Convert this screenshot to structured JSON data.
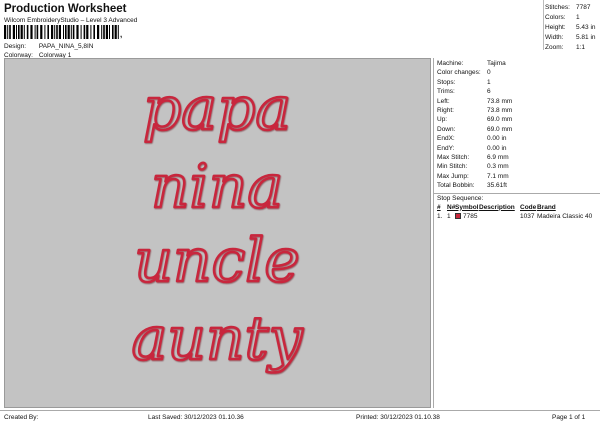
{
  "header": {
    "title": "Production Worksheet",
    "subtitle": "Wilcom EmbroideryStudio – Level 3 Advanced",
    "design_label": "Design:",
    "design_value": "PAPA_NINA_5,8IN",
    "colorway_label": "Colorway:",
    "colorway_value": "Colorway 1",
    "barcode_suffix": ","
  },
  "summary": [
    {
      "k": "Stitches:",
      "v": "7787"
    },
    {
      "k": "Colors:",
      "v": "1"
    },
    {
      "k": "Height:",
      "v": "5.43 in"
    },
    {
      "k": "Width:",
      "v": "5.81 in"
    },
    {
      "k": "Zoom:",
      "v": "1:1"
    }
  ],
  "params": [
    {
      "k": "Machine:",
      "v": "Tajima"
    },
    {
      "k": "Color changes:",
      "v": "0"
    },
    {
      "k": "Stops:",
      "v": "1"
    },
    {
      "k": "Trims:",
      "v": "6"
    },
    {
      "k": "Left:",
      "v": "73.8 mm"
    },
    {
      "k": "Right:",
      "v": "73.8 mm"
    },
    {
      "k": "Up:",
      "v": "69.0 mm"
    },
    {
      "k": "Down:",
      "v": "69.0 mm"
    },
    {
      "k": "EndX:",
      "v": "0.00 in"
    },
    {
      "k": "EndY:",
      "v": "0.00 in"
    },
    {
      "k": "Max Stitch:",
      "v": "6.9 mm"
    },
    {
      "k": "Min Stitch:",
      "v": "0.3 mm"
    },
    {
      "k": "Max Jump:",
      "v": "7.1 mm"
    },
    {
      "k": "Total Bobbin:",
      "v": "35.61ft"
    }
  ],
  "stop_sequence": {
    "title": "Stop Sequence:",
    "headers": [
      "#",
      "N#",
      "Symbol",
      "Description",
      "Code",
      "Brand"
    ],
    "rows": [
      {
        "n": "1.",
        "nn": "1",
        "color": "#c8283c",
        "desc": "7785",
        "code": "1037",
        "brand": "Madeira Classic 40"
      }
    ]
  },
  "design_words": [
    "papa",
    "nina",
    "uncle",
    "aunty"
  ],
  "thread_color": "#c8283c",
  "footer": {
    "created_by": "Created By:",
    "last_saved": "Last Saved:  30/12/2023 01.10.36",
    "printed": "Printed:  30/12/2023 01.10.38",
    "page": "Page 1 of 1"
  }
}
